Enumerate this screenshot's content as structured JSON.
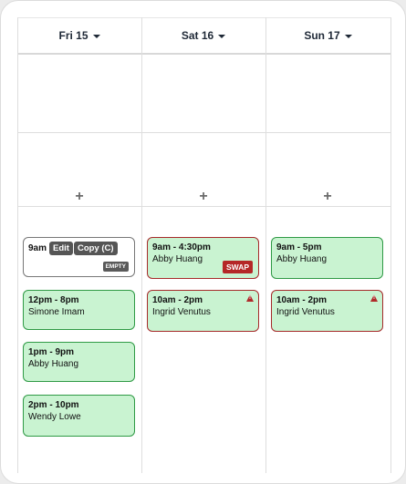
{
  "header": {
    "days": [
      {
        "label": "Fri 15"
      },
      {
        "label": "Sat 16"
      },
      {
        "label": "Sun 17"
      }
    ]
  },
  "add_symbol": "+",
  "friday": {
    "draft_shift": {
      "time": "9am",
      "edit_label": "Edit",
      "copy_label": "Copy (C)",
      "badge": "EMPTY"
    },
    "shifts": [
      {
        "time": "12pm - 8pm",
        "name": "Simone Imam"
      },
      {
        "time": "1pm - 9pm",
        "name": "Abby Huang"
      },
      {
        "time": "2pm - 10pm",
        "name": "Wendy Lowe"
      }
    ]
  },
  "saturday": {
    "shifts": [
      {
        "time": "9am - 4:30pm",
        "name": "Abby Huang",
        "badge": "SWAP"
      },
      {
        "time": "10am - 2pm",
        "name": "Ingrid Venutus"
      }
    ]
  },
  "sunday": {
    "shifts": [
      {
        "time": "9am - 5pm",
        "name": "Abby Huang"
      },
      {
        "time": "10am - 2pm",
        "name": "Ingrid Venutus"
      }
    ]
  },
  "colors": {
    "shift_fill": "#c9f3d1",
    "shift_border_ok": "#2f9a45",
    "shift_border_warning": "#a62a2a",
    "swap_badge": "#b52727",
    "empty_badge": "#5a5a5a"
  }
}
